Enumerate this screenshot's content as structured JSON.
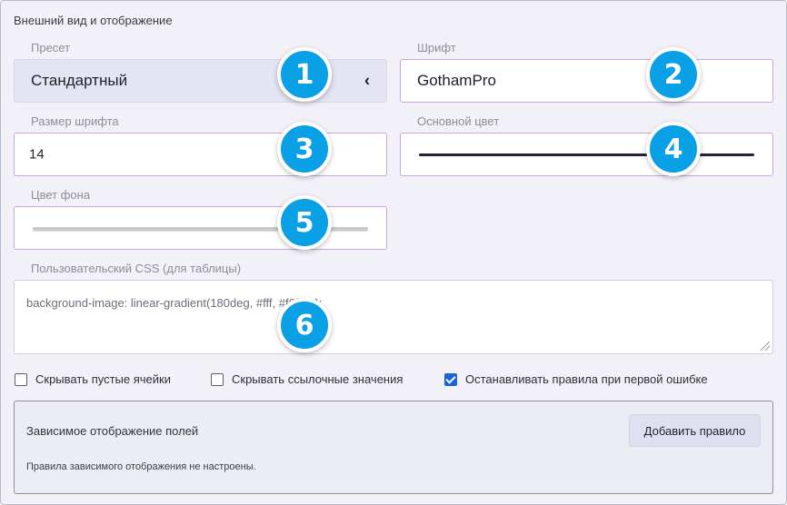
{
  "section_title": "Внешний вид и отображение",
  "preset": {
    "label": "Пресет",
    "value": "Стандартный",
    "chevron": "‹"
  },
  "font": {
    "label": "Шрифт",
    "value": "GothamPro"
  },
  "font_size": {
    "label": "Размер шрифта",
    "value": "14"
  },
  "primary_color": {
    "label": "Основной цвет",
    "color": "#1f2438"
  },
  "background_color": {
    "label": "Цвет фона",
    "color": "#c8c8ce"
  },
  "custom_css": {
    "label": "Пользовательский CSS (для таблицы)",
    "value": "background-image: linear-gradient(180deg, #fff, #f6f7fb);"
  },
  "checkboxes": [
    {
      "label": "Скрывать пустые ячейки",
      "checked": false
    },
    {
      "label": "Скрывать ссылочные значения",
      "checked": false
    },
    {
      "label": "Останавливать правила при первой ошибке",
      "checked": true
    }
  ],
  "conditional_display": {
    "title": "Зависимое отображение полей",
    "add_button": "Добавить правило",
    "empty_text": "Правила зависимого отображения не настроены."
  },
  "badges": [
    "1",
    "2",
    "3",
    "4",
    "5",
    "6"
  ],
  "colors": {
    "accent": "#0aa0e6",
    "checkbox_checked": "#1a64d9",
    "field_border": "#c9a4df"
  }
}
